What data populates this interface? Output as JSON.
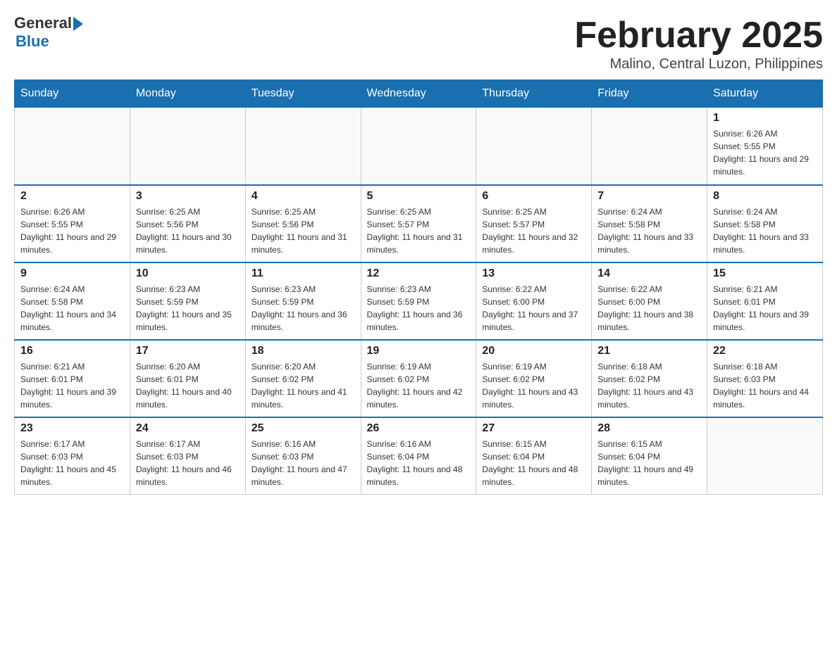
{
  "header": {
    "logo_general": "General",
    "logo_blue": "Blue",
    "month_title": "February 2025",
    "location": "Malino, Central Luzon, Philippines"
  },
  "days_of_week": [
    "Sunday",
    "Monday",
    "Tuesday",
    "Wednesday",
    "Thursday",
    "Friday",
    "Saturday"
  ],
  "weeks": [
    [
      {
        "day": "",
        "info": ""
      },
      {
        "day": "",
        "info": ""
      },
      {
        "day": "",
        "info": ""
      },
      {
        "day": "",
        "info": ""
      },
      {
        "day": "",
        "info": ""
      },
      {
        "day": "",
        "info": ""
      },
      {
        "day": "1",
        "info": "Sunrise: 6:26 AM\nSunset: 5:55 PM\nDaylight: 11 hours and 29 minutes."
      }
    ],
    [
      {
        "day": "2",
        "info": "Sunrise: 6:26 AM\nSunset: 5:55 PM\nDaylight: 11 hours and 29 minutes."
      },
      {
        "day": "3",
        "info": "Sunrise: 6:25 AM\nSunset: 5:56 PM\nDaylight: 11 hours and 30 minutes."
      },
      {
        "day": "4",
        "info": "Sunrise: 6:25 AM\nSunset: 5:56 PM\nDaylight: 11 hours and 31 minutes."
      },
      {
        "day": "5",
        "info": "Sunrise: 6:25 AM\nSunset: 5:57 PM\nDaylight: 11 hours and 31 minutes."
      },
      {
        "day": "6",
        "info": "Sunrise: 6:25 AM\nSunset: 5:57 PM\nDaylight: 11 hours and 32 minutes."
      },
      {
        "day": "7",
        "info": "Sunrise: 6:24 AM\nSunset: 5:58 PM\nDaylight: 11 hours and 33 minutes."
      },
      {
        "day": "8",
        "info": "Sunrise: 6:24 AM\nSunset: 5:58 PM\nDaylight: 11 hours and 33 minutes."
      }
    ],
    [
      {
        "day": "9",
        "info": "Sunrise: 6:24 AM\nSunset: 5:58 PM\nDaylight: 11 hours and 34 minutes."
      },
      {
        "day": "10",
        "info": "Sunrise: 6:23 AM\nSunset: 5:59 PM\nDaylight: 11 hours and 35 minutes."
      },
      {
        "day": "11",
        "info": "Sunrise: 6:23 AM\nSunset: 5:59 PM\nDaylight: 11 hours and 36 minutes."
      },
      {
        "day": "12",
        "info": "Sunrise: 6:23 AM\nSunset: 5:59 PM\nDaylight: 11 hours and 36 minutes."
      },
      {
        "day": "13",
        "info": "Sunrise: 6:22 AM\nSunset: 6:00 PM\nDaylight: 11 hours and 37 minutes."
      },
      {
        "day": "14",
        "info": "Sunrise: 6:22 AM\nSunset: 6:00 PM\nDaylight: 11 hours and 38 minutes."
      },
      {
        "day": "15",
        "info": "Sunrise: 6:21 AM\nSunset: 6:01 PM\nDaylight: 11 hours and 39 minutes."
      }
    ],
    [
      {
        "day": "16",
        "info": "Sunrise: 6:21 AM\nSunset: 6:01 PM\nDaylight: 11 hours and 39 minutes."
      },
      {
        "day": "17",
        "info": "Sunrise: 6:20 AM\nSunset: 6:01 PM\nDaylight: 11 hours and 40 minutes."
      },
      {
        "day": "18",
        "info": "Sunrise: 6:20 AM\nSunset: 6:02 PM\nDaylight: 11 hours and 41 minutes."
      },
      {
        "day": "19",
        "info": "Sunrise: 6:19 AM\nSunset: 6:02 PM\nDaylight: 11 hours and 42 minutes."
      },
      {
        "day": "20",
        "info": "Sunrise: 6:19 AM\nSunset: 6:02 PM\nDaylight: 11 hours and 43 minutes."
      },
      {
        "day": "21",
        "info": "Sunrise: 6:18 AM\nSunset: 6:02 PM\nDaylight: 11 hours and 43 minutes."
      },
      {
        "day": "22",
        "info": "Sunrise: 6:18 AM\nSunset: 6:03 PM\nDaylight: 11 hours and 44 minutes."
      }
    ],
    [
      {
        "day": "23",
        "info": "Sunrise: 6:17 AM\nSunset: 6:03 PM\nDaylight: 11 hours and 45 minutes."
      },
      {
        "day": "24",
        "info": "Sunrise: 6:17 AM\nSunset: 6:03 PM\nDaylight: 11 hours and 46 minutes."
      },
      {
        "day": "25",
        "info": "Sunrise: 6:16 AM\nSunset: 6:03 PM\nDaylight: 11 hours and 47 minutes."
      },
      {
        "day": "26",
        "info": "Sunrise: 6:16 AM\nSunset: 6:04 PM\nDaylight: 11 hours and 48 minutes."
      },
      {
        "day": "27",
        "info": "Sunrise: 6:15 AM\nSunset: 6:04 PM\nDaylight: 11 hours and 48 minutes."
      },
      {
        "day": "28",
        "info": "Sunrise: 6:15 AM\nSunset: 6:04 PM\nDaylight: 11 hours and 49 minutes."
      },
      {
        "day": "",
        "info": ""
      }
    ]
  ]
}
